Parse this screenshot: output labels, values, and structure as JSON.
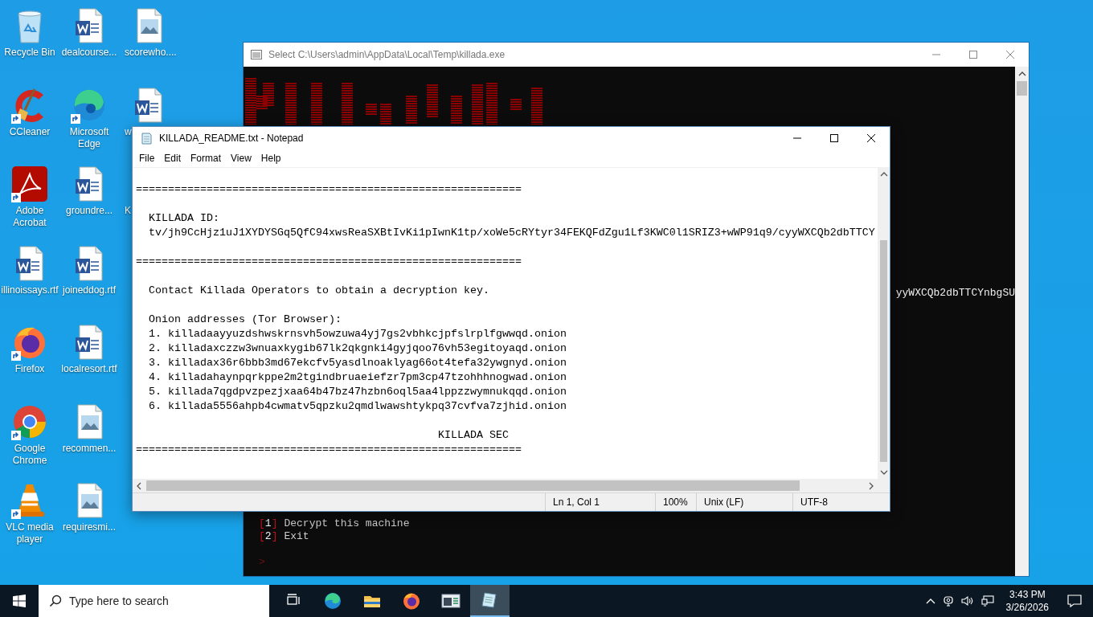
{
  "desktop_icons": [
    {
      "label": "Recycle Bin",
      "kind": "recycle",
      "shortcut": false
    },
    {
      "label": "CCleaner",
      "kind": "ccleaner",
      "shortcut": true
    },
    {
      "label": "Adobe Acrobat",
      "kind": "acrobat",
      "shortcut": true
    },
    {
      "label": "illinoissays.rtf",
      "kind": "word",
      "shortcut": false
    },
    {
      "label": "Firefox",
      "kind": "firefox",
      "shortcut": true
    },
    {
      "label": "Google Chrome",
      "kind": "chrome",
      "shortcut": true
    },
    {
      "label": "VLC media player",
      "kind": "vlc",
      "shortcut": true
    },
    {
      "label": "dealcourse...",
      "kind": "word",
      "shortcut": false
    },
    {
      "label": "Microsoft Edge",
      "kind": "edge",
      "shortcut": true
    },
    {
      "label": "groundre...",
      "kind": "word",
      "shortcut": false
    },
    {
      "label": "joineddog.rtf",
      "kind": "word",
      "shortcut": false
    },
    {
      "label": "localresort.rtf",
      "kind": "word",
      "shortcut": false
    },
    {
      "label": "recommen...",
      "kind": "image",
      "shortcut": false
    },
    {
      "label": "requiresmi...",
      "kind": "image",
      "shortcut": false
    },
    {
      "label": "scorewho....",
      "kind": "image",
      "shortcut": false
    },
    {
      "label": "w",
      "kind": "word",
      "shortcut": false
    },
    {
      "label": "K",
      "kind": "hidden"
    }
  ],
  "console_window": {
    "title": "Select C:\\Users\\admin\\AppData\\Local\\Temp\\killada.exe",
    "id_line": "yyWXCQb2dbTTCYnbgSU",
    "menu": [
      {
        "open": "[",
        "key": "1",
        "close": "]",
        "label": "Decrypt this machine"
      },
      {
        "open": "[",
        "key": "2",
        "close": "]",
        "label": "Exit"
      }
    ],
    "prompt": ">"
  },
  "notepad": {
    "title": "KILLADA_README.txt - Notepad",
    "menu": [
      "File",
      "Edit",
      "Format",
      "View",
      "Help"
    ],
    "text": "\n============================================================\n\n  KILLADA ID:\n  tv/jh9CcHjz1uJ1XYDYSGq5QfC94xwsReaSXBtIvKi1pIwnK1tp/xoWe5cRYtyr34FEKQFdZgu1Lf3KWC0l1SRIZ3+wWP91q9/cyyWXCQb2dbTTCY\n\n============================================================\n\n  Contact Killada Operators to obtain a decryption key.\n\n  Onion addresses (Tor Browser):\n  1. killadaayyuzdshwskrnsvh5owzuwa4yj7gs2vbhkcjpfslrplfgwwqd.onion\n  2. killadaxczzw3wnuaxkygib67lk2qkgnki4gyjqoo76vh53egitoyaqd.onion\n  3. killadax36r6bbb3md67ekcfv5yasdlnoaklyag66ot4tefa32ywgnyd.onion\n  4. killadahaynpqrkppe2m2tgindbruaeiefzr7pm3cp47tzohhhnogwad.onion\n  5. killada7qgdpvzpezjxaa64b47bz47hzbn6oql5aa4lppzzwymnukqqd.onion\n  6. killada5556ahpb4cwmatv5qpzku2qmdlwawshtykpq37cvfva7zjhid.onion\n\n                                               KILLADA SEC\n============================================================",
    "status": [
      "Ln 1, Col 1",
      "100%",
      "Unix (LF)",
      "UTF-8"
    ]
  },
  "taskbar": {
    "search": {
      "placeholder": "Type here to search"
    },
    "apps": [
      {
        "kind": "taskview",
        "active": false
      },
      {
        "kind": "edge",
        "active": false
      },
      {
        "kind": "folder",
        "active": false
      },
      {
        "kind": "firefox",
        "active": false
      },
      {
        "kind": "console",
        "active": false
      },
      {
        "kind": "notepad",
        "active": true
      }
    ],
    "time": "3:43 PM",
    "date": "3/26/2026"
  }
}
